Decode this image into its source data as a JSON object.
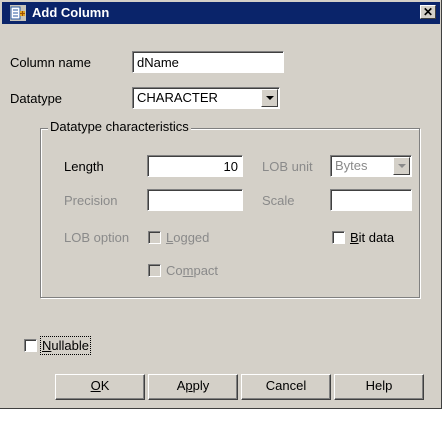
{
  "window": {
    "title": "Add Column",
    "close_glyph": "✕"
  },
  "column_name": {
    "label": "Column name",
    "value": "dName"
  },
  "datatype": {
    "label": "Datatype",
    "value": "CHARACTER"
  },
  "characteristics": {
    "group_title": "Datatype characteristics",
    "length_label": "Length",
    "length_value": "10",
    "lob_unit_label": "LOB unit",
    "lob_unit_value": "Bytes",
    "precision_label": "Precision",
    "precision_value": "",
    "scale_label": "Scale",
    "scale_value": "",
    "lob_option_label": "LOB option",
    "logged_label_pre": "",
    "logged_mnemonic": "L",
    "logged_label_post": "ogged",
    "logged_checked": false,
    "compact_label_pre": "Co",
    "compact_mnemonic": "m",
    "compact_label_post": "pact",
    "compact_checked": false,
    "bitdata_label_pre": "",
    "bitdata_mnemonic": "B",
    "bitdata_label_post": "it data",
    "bitdata_checked": false
  },
  "nullable": {
    "label_pre": "",
    "mnemonic": "N",
    "label_post": "ullable",
    "checked": false
  },
  "buttons": {
    "ok_mnemonic": "O",
    "ok_post": "K",
    "apply_pre": "A",
    "apply_mnemonic": "p",
    "apply_post": "ply",
    "cancel": "Cancel",
    "help": "Help"
  }
}
